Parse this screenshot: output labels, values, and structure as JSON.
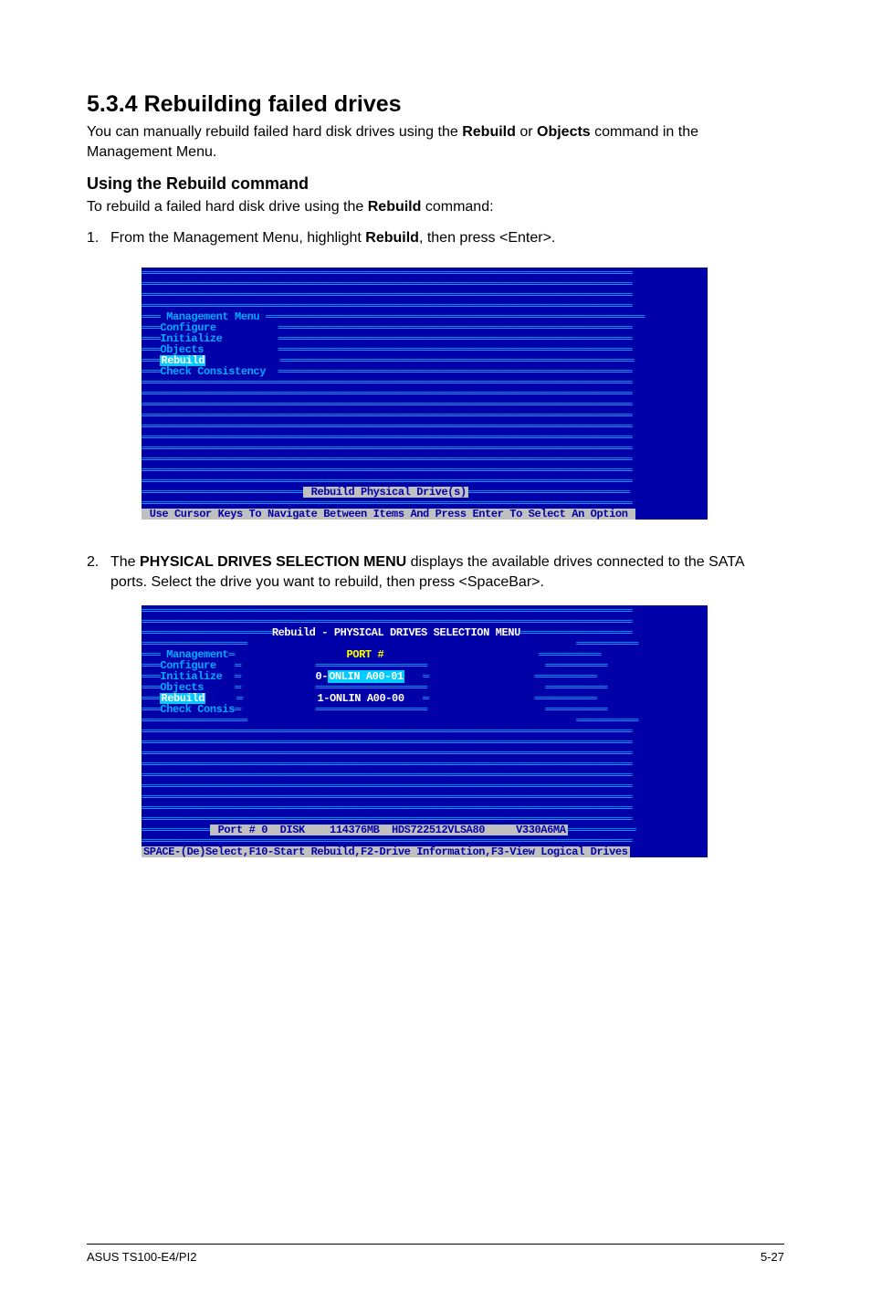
{
  "section": {
    "number": "5.3.4",
    "title": "Rebuilding failed drives",
    "intro_pre": "You can manually rebuild failed hard disk drives using the ",
    "intro_bold1": "Rebuild",
    "intro_mid": " or ",
    "intro_bold2": "Objects",
    "intro_post": " command in the Management Menu."
  },
  "sub": {
    "heading": "Using the Rebuild command",
    "line1_pre": "To rebuild a failed hard disk drive using the ",
    "line1_bold": "Rebuild",
    "line1_post": " command:"
  },
  "steps": {
    "s1": {
      "num": "1.",
      "pre": "From the Management Menu, highlight ",
      "bold": "Rebuild",
      "post": ", then press <Enter>."
    },
    "s2": {
      "num": "2.",
      "pre": "The ",
      "bold": "PHYSICAL DRIVES SELECTION MENU",
      "post": " displays the available drives connected to the SATA ports. Select the drive you want to rebuild, then press <SpaceBar>."
    }
  },
  "bios1": {
    "menu_title": "Management Menu",
    "items": {
      "configure": "Configure",
      "initialize": "Initialize",
      "objects": "Objects",
      "rebuild": "Rebuild",
      "check": "Check Consistency"
    },
    "action_bar": " Rebuild Physical Drive(s)",
    "hint": " Use Cursor Keys To Navigate Between Items And Press Enter To Select An Option "
  },
  "bios2": {
    "title": "Rebuild - PHYSICAL DRIVES SELECTION MENU",
    "left_menu": {
      "header": "Management",
      "configure": "Configure",
      "initialize": "Initialize",
      "objects": "Objects",
      "rebuild": "Rebuild",
      "check": "Check Consis"
    },
    "port_header": "PORT #",
    "port0": "0-ONLIN A00-01",
    "port1": "1-ONLIN A00-00",
    "info_bar": " Port # 0  DISK    114376MB  HDS722512VLSA80     V330A6MA",
    "hint": "SPACE-(De)Select,F10-Start Rebuild,F2-Drive Information,F3-View Logical Drives"
  },
  "footer": {
    "left": "ASUS TS100-E4/PI2",
    "right": "5-27"
  }
}
